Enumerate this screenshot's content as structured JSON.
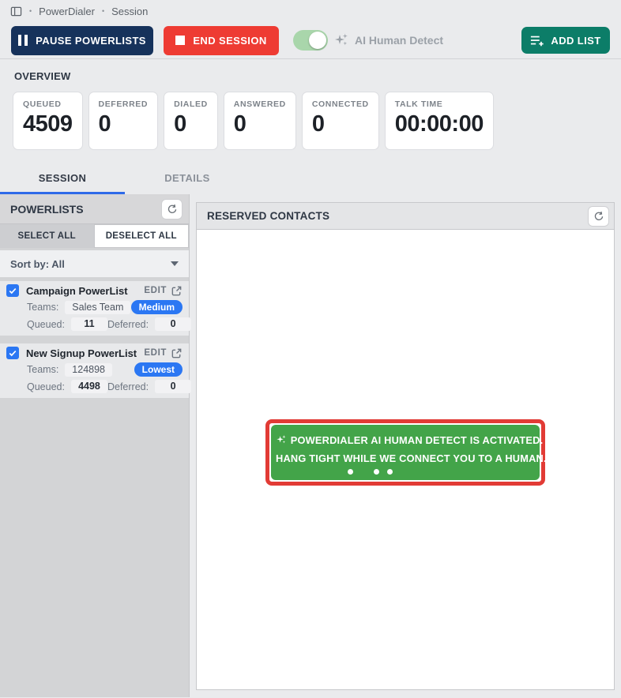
{
  "breadcrumb": {
    "separator": "•",
    "items": [
      "PowerDialer",
      "Session"
    ]
  },
  "toolbar": {
    "pause_label": "PAUSE POWERLISTS",
    "end_label": "END SESSION",
    "ai_toggle": {
      "label": "AI Human Detect",
      "state": "on"
    },
    "add_list_label": "ADD LIST"
  },
  "overview": {
    "title": "OVERVIEW",
    "stats": [
      {
        "label": "QUEUED",
        "value": "4509"
      },
      {
        "label": "DEFERRED",
        "value": "0"
      },
      {
        "label": "DIALED",
        "value": "0"
      },
      {
        "label": "ANSWERED",
        "value": "0"
      },
      {
        "label": "CONNECTED",
        "value": "0"
      },
      {
        "label": "TALK TIME",
        "value": "00:00:00"
      }
    ]
  },
  "tabs": {
    "session": "SESSION",
    "details": "DETAILS",
    "active": "SESSION"
  },
  "powerlists": {
    "title": "POWERLISTS",
    "select_all_label": "SELECT ALL",
    "deselect_all_label": "DESELECT ALL",
    "sort_label": "Sort by: All",
    "items": [
      {
        "name": "Campaign PowerList",
        "checked": true,
        "edit_label": "EDIT",
        "teams_label": "Teams:",
        "teams_value": "Sales Team",
        "priority": "Medium",
        "queued_label": "Queued:",
        "queued_value": "11",
        "deferred_label": "Deferred:",
        "deferred_value": "0"
      },
      {
        "name": "New Signup PowerList",
        "checked": true,
        "edit_label": "EDIT",
        "teams_label": "Teams:",
        "teams_value": "124898",
        "priority": "Lowest",
        "queued_label": "Queued:",
        "queued_value": "4498",
        "deferred_label": "Deferred:",
        "deferred_value": "0"
      }
    ]
  },
  "reserved": {
    "title": "RESERVED CONTACTS",
    "banner": {
      "line1": "POWERDIALER AI HUMAN DETECT IS ACTIVATED.",
      "line2": "HANG TIGHT WHILE WE CONNECT YOU TO A HUMAN."
    }
  },
  "colors": {
    "navy": "#16325B",
    "red": "#EE3B33",
    "teal": "#0C7D68",
    "accent_blue": "#2B77F3",
    "tab_underline_blue": "#2E6AE8",
    "toggle_green": "#A9D6AB",
    "banner_green": "#43A449",
    "banner_border_red": "#E23B35"
  }
}
